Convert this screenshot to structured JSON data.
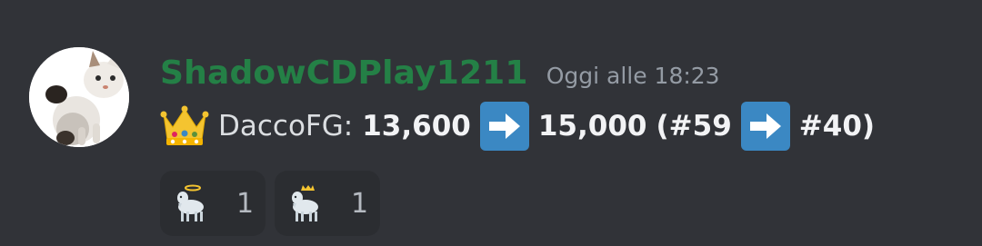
{
  "message": {
    "username": "ShadowCDPlay1211",
    "timestamp": "Oggi alle 18:23",
    "avatar_icon": "cat-photo-avatar",
    "content": {
      "prefix_icon": "crown-icon",
      "player": "DaccoFG:",
      "score_from": "13,600",
      "score_to": "15,000",
      "rank_open": "(#59",
      "rank_close": "#40)",
      "arrow_icon": "right-arrow-icon"
    }
  },
  "reactions": [
    {
      "icon": "goat-halo-icon",
      "count": "1"
    },
    {
      "icon": "goat-crown-icon",
      "count": "1"
    }
  ],
  "colors": {
    "background": "#313338",
    "username": "#248046",
    "timestamp": "#949ba4",
    "arrow_box": "#3b88c3",
    "reaction_bg": "#2b2d31"
  }
}
